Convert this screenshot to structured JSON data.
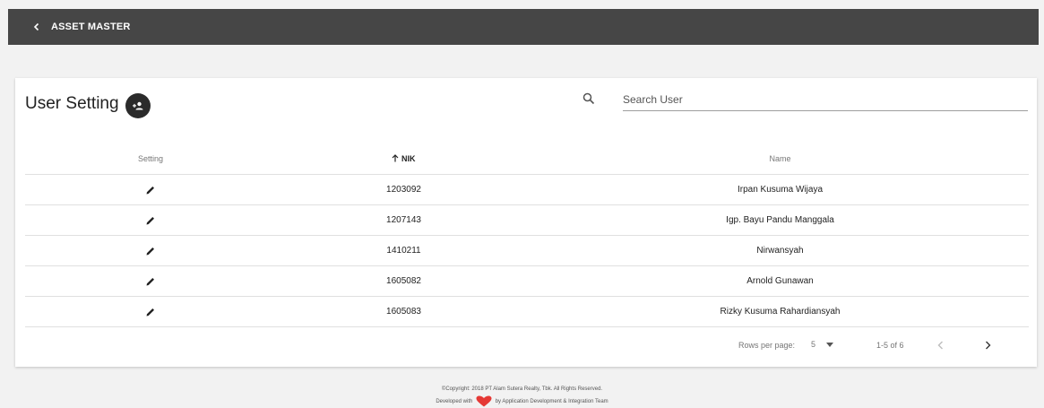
{
  "app": {
    "title": "ASSET MASTER"
  },
  "page": {
    "title": "User Setting"
  },
  "search": {
    "placeholder": "Search User",
    "value": ""
  },
  "table": {
    "columns": {
      "setting": "Setting",
      "nik": "NIK",
      "name": "Name"
    },
    "sort": {
      "column": "nik",
      "direction": "asc"
    },
    "rows": [
      {
        "nik": "1203092",
        "name": "Irpan Kusuma Wijaya"
      },
      {
        "nik": "1207143",
        "name": "Igp. Bayu Pandu Manggala"
      },
      {
        "nik": "1410211",
        "name": "Nirwansyah"
      },
      {
        "nik": "1605082",
        "name": "Arnold Gunawan"
      },
      {
        "nik": "1605083",
        "name": "Rizky Kusuma Rahardiansyah"
      }
    ]
  },
  "pagination": {
    "rows_per_page_label": "Rows per page:",
    "rows_per_page": "5",
    "range": "1-5 of 6"
  },
  "footer": {
    "copyright": "©Copyright: 2018 PT Alam Sutera Realty, Tbk. All Rights Reserved.",
    "developed_prefix": "Developed with",
    "developed_suffix": "by Application Development & Integration Team"
  },
  "icons": {
    "back": "chevron-left-icon",
    "add_user": "person-add-icon",
    "search": "search-icon",
    "edit": "pencil-icon",
    "sort": "arrow-up-icon",
    "prev": "chevron-left-icon",
    "next": "chevron-right-icon",
    "heart": "heart-icon"
  },
  "colors": {
    "topbar": "#464646",
    "background": "#f2f2f2",
    "heart": "#e53935"
  }
}
